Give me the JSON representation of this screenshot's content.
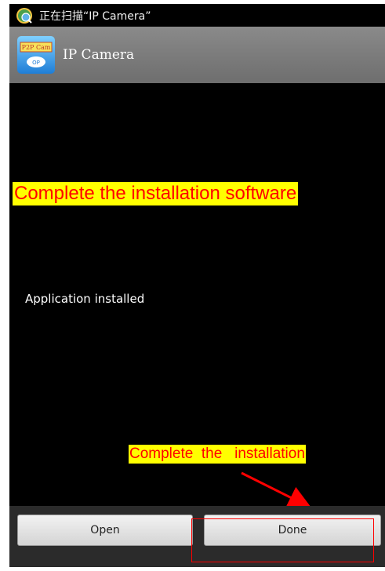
{
  "status_bar": {
    "text": "正在扫描“IP Camera”",
    "icon": "scan-app-icon"
  },
  "app_bar": {
    "title": "IP Camera",
    "icon": "p2pcam-app-icon",
    "icon_text_top": "P2P Cam",
    "icon_text_bottom": "OP"
  },
  "annotations": {
    "top": "Complete the installation software",
    "bottom": "Complete  the   installation"
  },
  "main": {
    "status_message": "Application installed"
  },
  "buttons": {
    "open_label": "Open",
    "done_label": "Done"
  },
  "colors": {
    "annotation_text": "#ff0000",
    "annotation_bg": "#ffff00",
    "screen_bg": "#000000"
  }
}
